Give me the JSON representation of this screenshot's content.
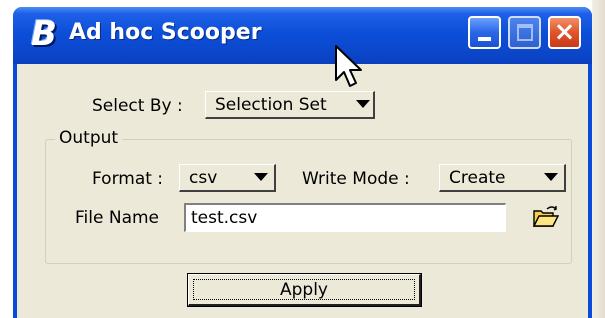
{
  "window": {
    "title": "Ad hoc Scooper",
    "app_icon": "B"
  },
  "title_buttons": {
    "minimize": "minimize-icon",
    "maximize": "maximize-icon",
    "close": "×"
  },
  "select_by": {
    "label": "Select By :",
    "value": "Selection Set"
  },
  "output": {
    "group_label": "Output",
    "format": {
      "label": "Format :",
      "value": "csv"
    },
    "write_mode": {
      "label": "Write Mode :",
      "value": "Create"
    },
    "file_name": {
      "label": "File Name",
      "value": "test.csv"
    },
    "browse_icon": "open-folder-icon"
  },
  "apply_button": {
    "label": "Apply"
  },
  "colors": {
    "title_bar": "#0b48cd",
    "dialog_face": "#ece9d8",
    "close_button": "#e0542a"
  }
}
